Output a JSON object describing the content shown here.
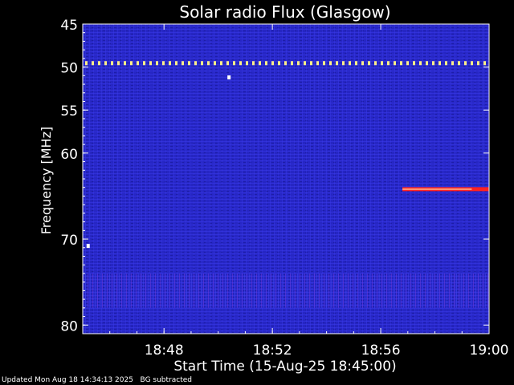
{
  "chart_data": {
    "type": "heatmap",
    "title": "Solar radio Flux (Glasgow)",
    "xlabel": "Start Time (15-Aug-25 18:45:00)",
    "ylabel": "Frequency [MHz]",
    "x_start": "18:45",
    "x_end": "19:00",
    "xlim_minutes": [
      0,
      15
    ],
    "x_ticks": [
      "18:48",
      "18:52",
      "18:56",
      "19:00"
    ],
    "x_tick_minutes": [
      3,
      7,
      11,
      15
    ],
    "ylim": [
      45,
      81
    ],
    "y_inverted": true,
    "y_ticks": [
      45,
      50,
      55,
      60,
      70,
      80
    ],
    "background_colormap": [
      "#1a1aa8",
      "#2a2ad0",
      "#3a3aea"
    ],
    "features": [
      {
        "kind": "persistent_line",
        "freq_mhz": 49.5,
        "t_start": 0,
        "t_end": 15,
        "color": "#ffee88"
      },
      {
        "kind": "burst",
        "freq_mhz": 64.2,
        "t_start": 11.8,
        "t_end": 15,
        "color": "#ff2222"
      },
      {
        "kind": "point",
        "freq_mhz": 51.2,
        "t": 5.4,
        "color": "#ffffff"
      },
      {
        "kind": "point",
        "freq_mhz": 70.8,
        "t": 0.2,
        "color": "#ffffff"
      },
      {
        "kind": "rfi_band",
        "freq_min": 74,
        "freq_max": 78,
        "t_start": 0,
        "t_end": 15
      }
    ]
  },
  "footer": {
    "updated": "Updated Mon Aug 18 14:34:13 2025",
    "note": "BG subtracted"
  },
  "colors": {
    "background": "#000000",
    "text": "#ffffff"
  }
}
